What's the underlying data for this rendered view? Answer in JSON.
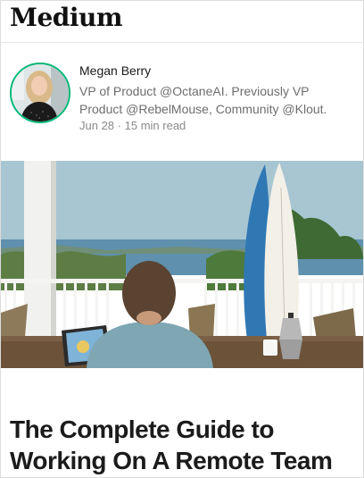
{
  "brand": {
    "logo": "Medium"
  },
  "author": {
    "name": "Megan Berry",
    "bio": "VP of Product @OctaneAI. Previously VP Product @RebelMouse, Community @Klout.",
    "date": "Jun 28",
    "separator": "·",
    "read_time": "15 min read"
  },
  "article": {
    "title": "The Complete Guide to Working On A Remote Team"
  },
  "colors": {
    "accent_ring": "#02b875",
    "title_text": "#1b1b1b"
  }
}
